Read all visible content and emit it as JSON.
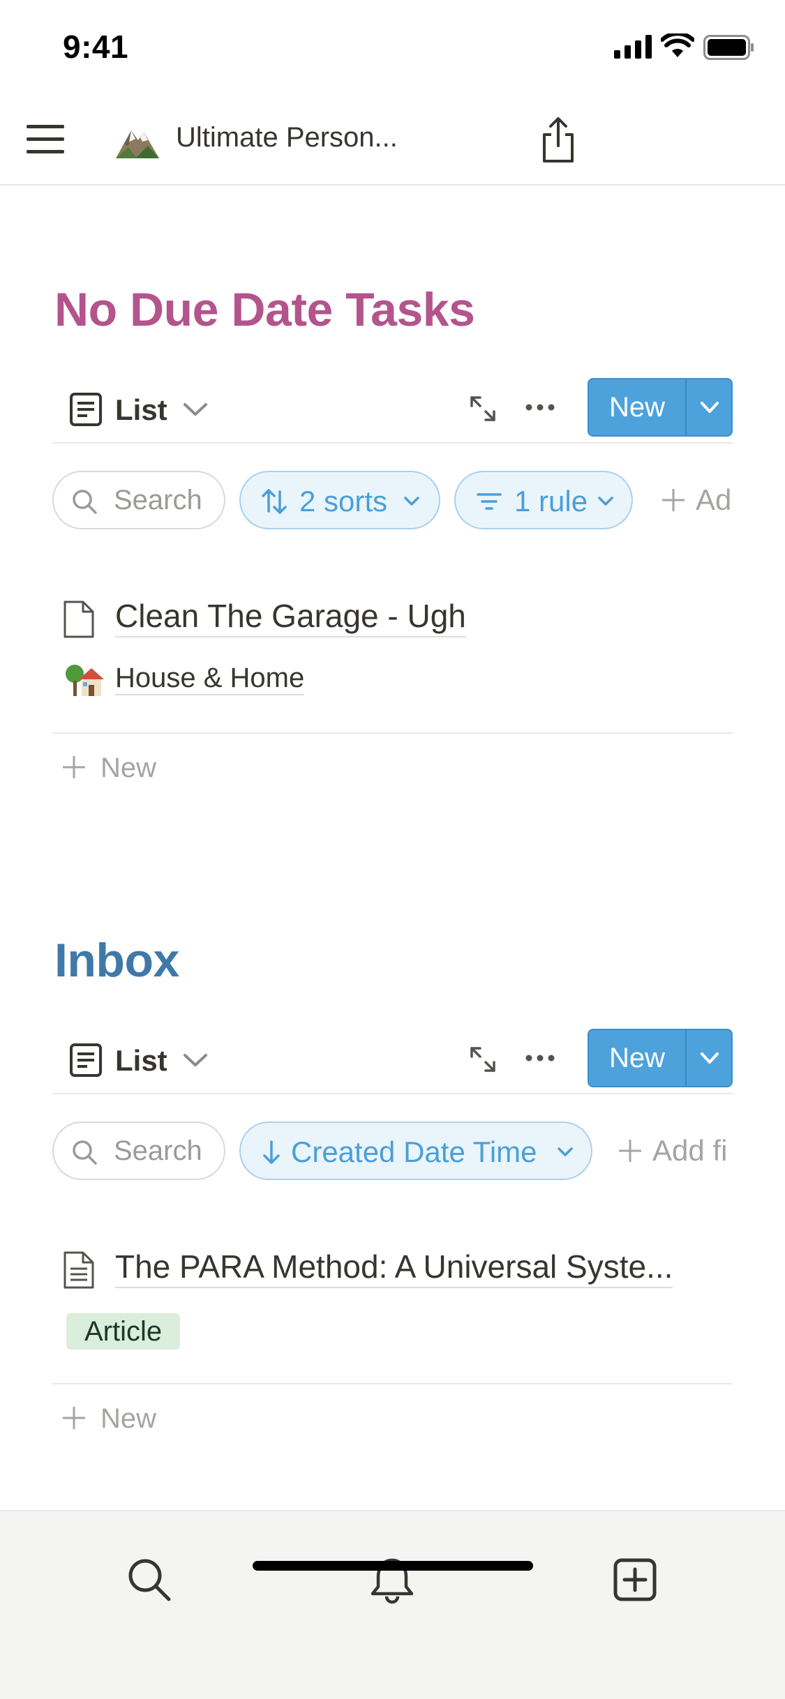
{
  "status_bar": {
    "time": "9:41"
  },
  "nav": {
    "title": "Ultimate Person..."
  },
  "sections": [
    {
      "title": "No Due Date Tasks",
      "title_color": "#b3548c",
      "view_label": "List",
      "new_label": "New",
      "search_placeholder": "Search",
      "sort_label": "2 sorts",
      "filter_label": "1 rule",
      "add_filter_label": "Ad",
      "item_title": "Clean The Garage - Ugh",
      "item_relation": "House & Home",
      "add_new_label": "New"
    },
    {
      "title": "Inbox",
      "title_color": "#3f79a8",
      "view_label": "List",
      "new_label": "New",
      "search_placeholder": "Search",
      "sort_label": "Created Date Time",
      "add_filter_label": "Add fi",
      "item_title": "The PARA Method: A Universal Syste...",
      "item_tag": "Article",
      "add_new_label": "New"
    }
  ],
  "colors": {
    "accent": "#4ea2dc",
    "tag_green_bg": "#dbeddb",
    "text": "#37352f"
  },
  "tabbar": {
    "icons": [
      "search-icon",
      "bell-icon",
      "add-page-icon"
    ]
  }
}
